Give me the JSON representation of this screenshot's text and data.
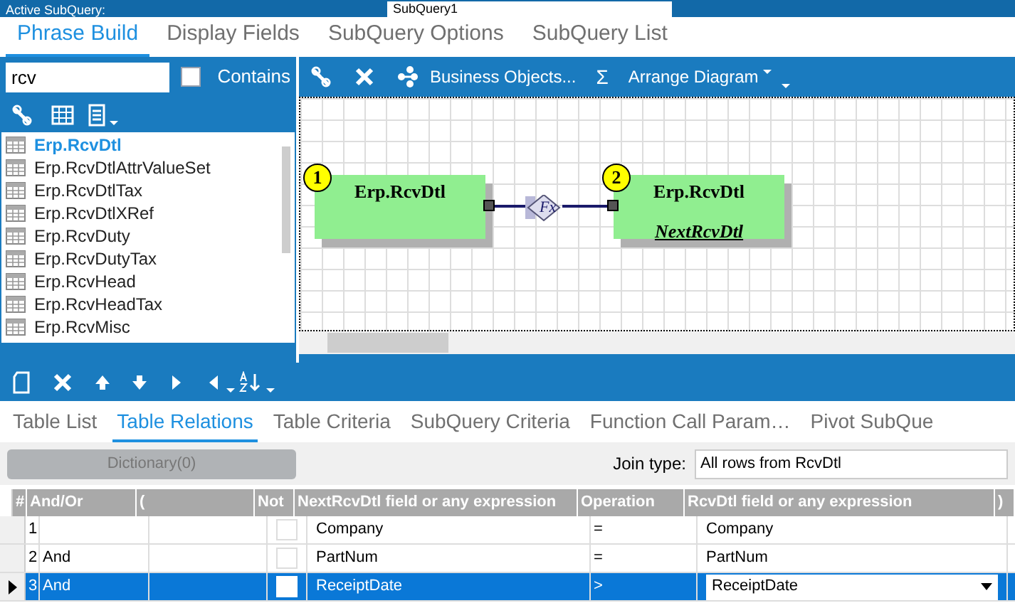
{
  "top_bar": {
    "label": "Active SubQuery:",
    "value": "SubQuery1"
  },
  "tabs": [
    {
      "label": "Phrase Build",
      "selected": true
    },
    {
      "label": "Display Fields",
      "selected": false
    },
    {
      "label": "SubQuery Options",
      "selected": false
    },
    {
      "label": "SubQuery List",
      "selected": false
    }
  ],
  "table_search": {
    "value": "rcv",
    "contains_label": "Contains",
    "contains_checked": false
  },
  "table_list": [
    {
      "label": "Erp.RcvDtl",
      "selected": true
    },
    {
      "label": "Erp.RcvDtlAttrValueSet",
      "selected": false
    },
    {
      "label": "Erp.RcvDtlTax",
      "selected": false
    },
    {
      "label": "Erp.RcvDtlXRef",
      "selected": false
    },
    {
      "label": "Erp.RcvDuty",
      "selected": false
    },
    {
      "label": "Erp.RcvDutyTax",
      "selected": false
    },
    {
      "label": "Erp.RcvHead",
      "selected": false
    },
    {
      "label": "Erp.RcvHeadTax",
      "selected": false
    },
    {
      "label": "Erp.RcvMisc",
      "selected": false
    }
  ],
  "diagram_toolbar": {
    "business_objects": "Business Objects...",
    "sum": "Σ",
    "arrange": "Arrange Diagram"
  },
  "diagram": {
    "nodes": [
      {
        "number": "1",
        "title": "Erp.RcvDtl"
      },
      {
        "number": "2",
        "title": "Erp.RcvDtl",
        "alias": "NextRcvDtl"
      }
    ],
    "link_label": "Fx"
  },
  "bottom_tabs": [
    {
      "label": "Table List",
      "selected": false
    },
    {
      "label": "Table Relations",
      "selected": true
    },
    {
      "label": "Table Criteria",
      "selected": false
    },
    {
      "label": "SubQuery Criteria",
      "selected": false
    },
    {
      "label": "Function Call Param…",
      "selected": false
    },
    {
      "label": "Pivot SubQue",
      "selected": false
    }
  ],
  "dictionary_button": {
    "label": "Dictionary(0)",
    "disabled": true
  },
  "join_type": {
    "label": "Join type:",
    "value": "All rows from RcvDtl"
  },
  "grid": {
    "columns": [
      "#",
      "And/Or",
      "(",
      "Not",
      "NextRcvDtl field or any expression",
      "Operation",
      "RcvDtl field or any expression",
      ")"
    ],
    "rows": [
      {
        "num": "1",
        "and_or": "",
        "paren": "",
        "not": false,
        "left": "Company",
        "operation": "=",
        "right": "Company",
        "selected": false
      },
      {
        "num": "2",
        "and_or": "And",
        "paren": "",
        "not": false,
        "left": "PartNum",
        "operation": "=",
        "right": "PartNum",
        "selected": false
      },
      {
        "num": "3",
        "and_or": "And",
        "paren": "",
        "not": false,
        "left": "ReceiptDate",
        "operation": ">",
        "right": "ReceiptDate",
        "selected": true
      }
    ]
  }
}
